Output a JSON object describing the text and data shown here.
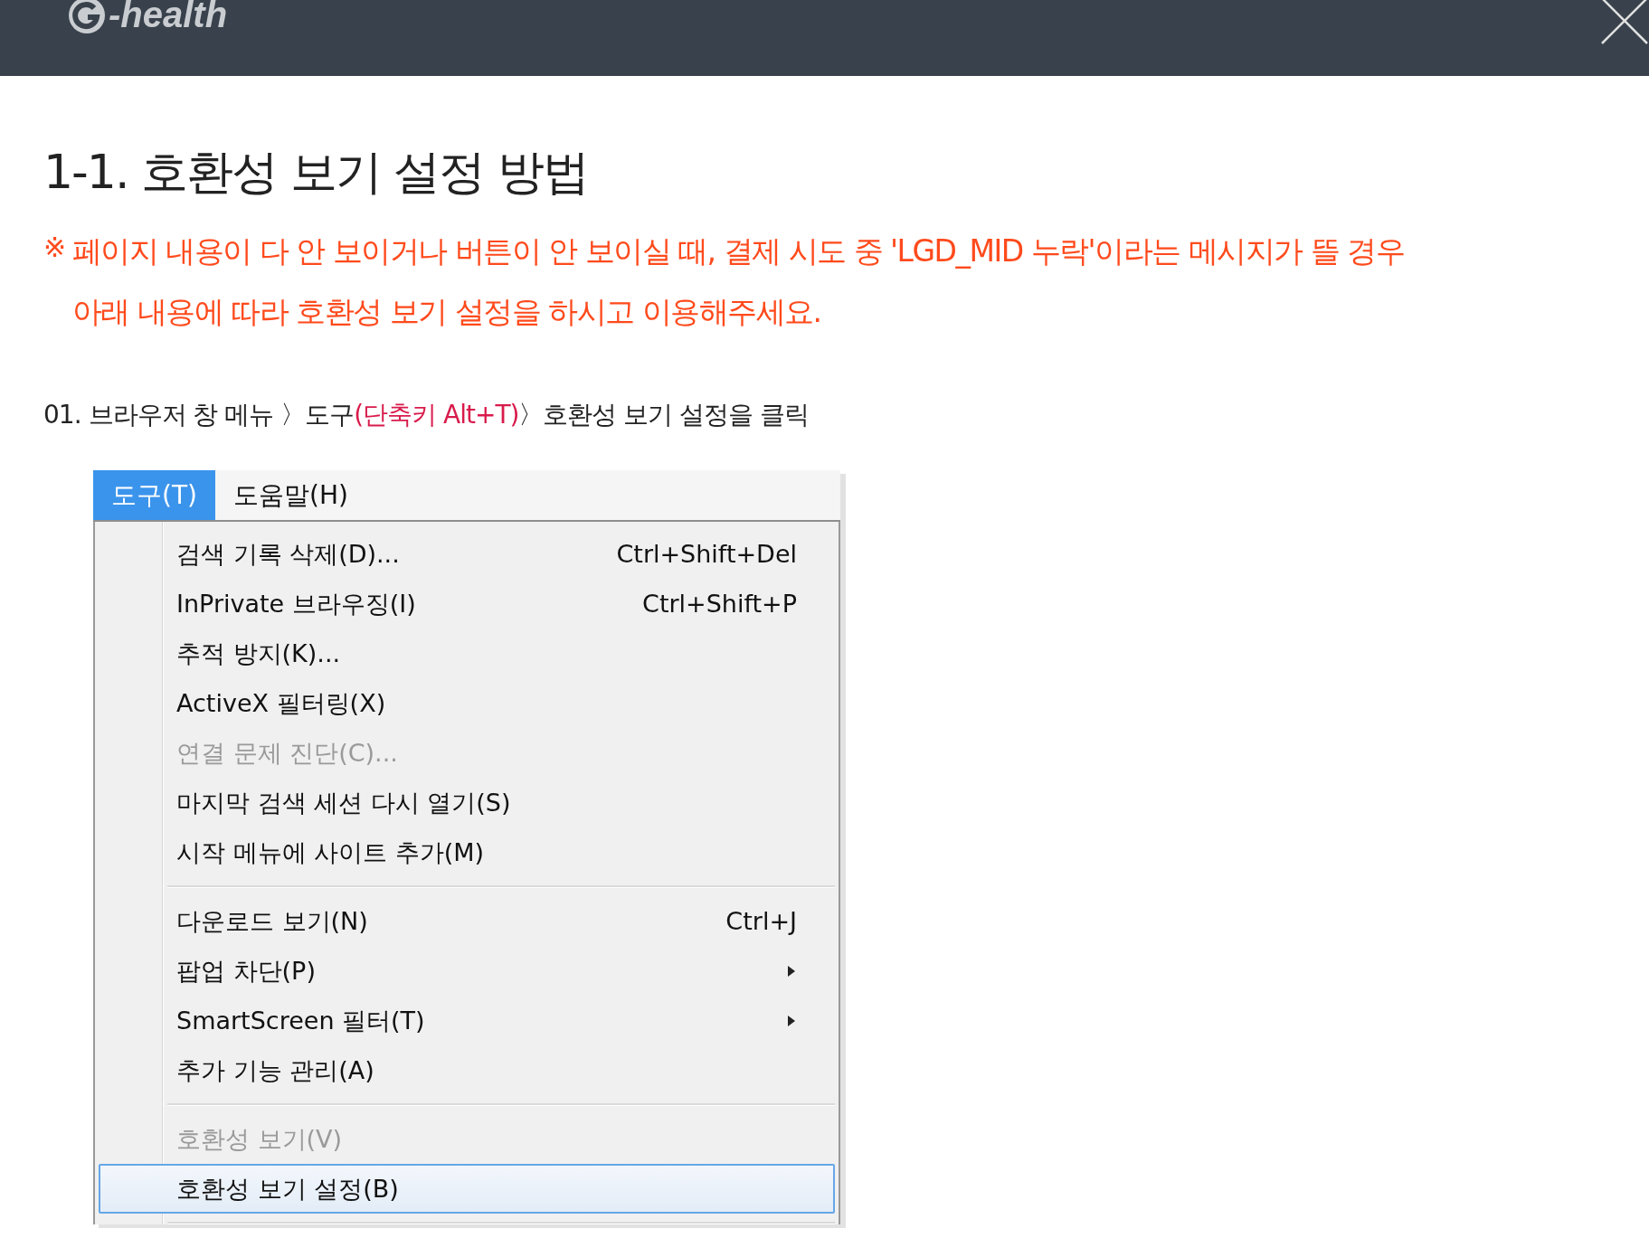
{
  "header": {
    "logo_text": "-health"
  },
  "title": "1-1. 호환성 보기 설정 방법",
  "notice": {
    "mark": "※",
    "lines": [
      "페이지 내용이 다 안 보이거나 버튼이 안 보이실 때, 결제 시도 중 'LGD_MID 누락'이라는 메시지가 뜰 경우",
      "아래 내용에 따라 호환성 보기 설정을 하시고 이용해주세요."
    ]
  },
  "step": {
    "number": "01.",
    "before": "브라우저 창 메뉴 〉도구",
    "shortcut": "(단축키 Alt+T)",
    "after": "〉호환성 보기 설정을 클릭"
  },
  "menu_bar": [
    {
      "label": "도구(T)",
      "selected": true
    },
    {
      "label": "도움말(H)",
      "selected": false
    }
  ],
  "menu_items": [
    {
      "kind": "item",
      "label": "검색 기록 삭제(D)...",
      "shortcut": "Ctrl+Shift+Del",
      "disabled": false,
      "selected": false,
      "submenu": false
    },
    {
      "kind": "item",
      "label": "InPrivate 브라우징(I)",
      "shortcut": "Ctrl+Shift+P",
      "disabled": false,
      "selected": false,
      "submenu": false
    },
    {
      "kind": "item",
      "label": "추적 방지(K)...",
      "disabled": false,
      "selected": false,
      "submenu": false
    },
    {
      "kind": "item",
      "label": "ActiveX 필터링(X)",
      "disabled": false,
      "selected": false,
      "submenu": false
    },
    {
      "kind": "item",
      "label": "연결 문제 진단(C)...",
      "disabled": true,
      "selected": false,
      "submenu": false
    },
    {
      "kind": "item",
      "label": "마지막 검색 세션 다시 열기(S)",
      "disabled": false,
      "selected": false,
      "submenu": false
    },
    {
      "kind": "item",
      "label": "시작 메뉴에 사이트 추가(M)",
      "disabled": false,
      "selected": false,
      "submenu": false
    },
    {
      "kind": "separator"
    },
    {
      "kind": "item",
      "label": "다운로드 보기(N)",
      "shortcut": "Ctrl+J",
      "disabled": false,
      "selected": false,
      "submenu": false
    },
    {
      "kind": "item",
      "label": "팝업 차단(P)",
      "disabled": false,
      "selected": false,
      "submenu": true
    },
    {
      "kind": "item",
      "label": "SmartScreen 필터(T)",
      "disabled": false,
      "selected": false,
      "submenu": true
    },
    {
      "kind": "item",
      "label": "추가 기능 관리(A)",
      "disabled": false,
      "selected": false,
      "submenu": false
    },
    {
      "kind": "separator"
    },
    {
      "kind": "item",
      "label": "호환성 보기(V)",
      "disabled": true,
      "selected": false,
      "submenu": false
    },
    {
      "kind": "item",
      "label": "호환성 보기 설정(B)",
      "disabled": false,
      "selected": true,
      "submenu": false
    },
    {
      "kind": "separator"
    }
  ]
}
